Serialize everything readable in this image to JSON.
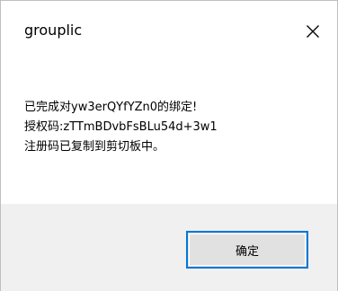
{
  "window": {
    "title": "grouplic",
    "close_icon": "close-icon"
  },
  "message": {
    "lines": [
      "已完成对yw3erQYfYZn0的绑定!",
      "授权码:zTTmBDvbFsBLu54d+3w1",
      "注册码已复制到剪切板中。"
    ]
  },
  "buttons": {
    "ok_label": "确定",
    "accent_color": "#0078d7"
  }
}
